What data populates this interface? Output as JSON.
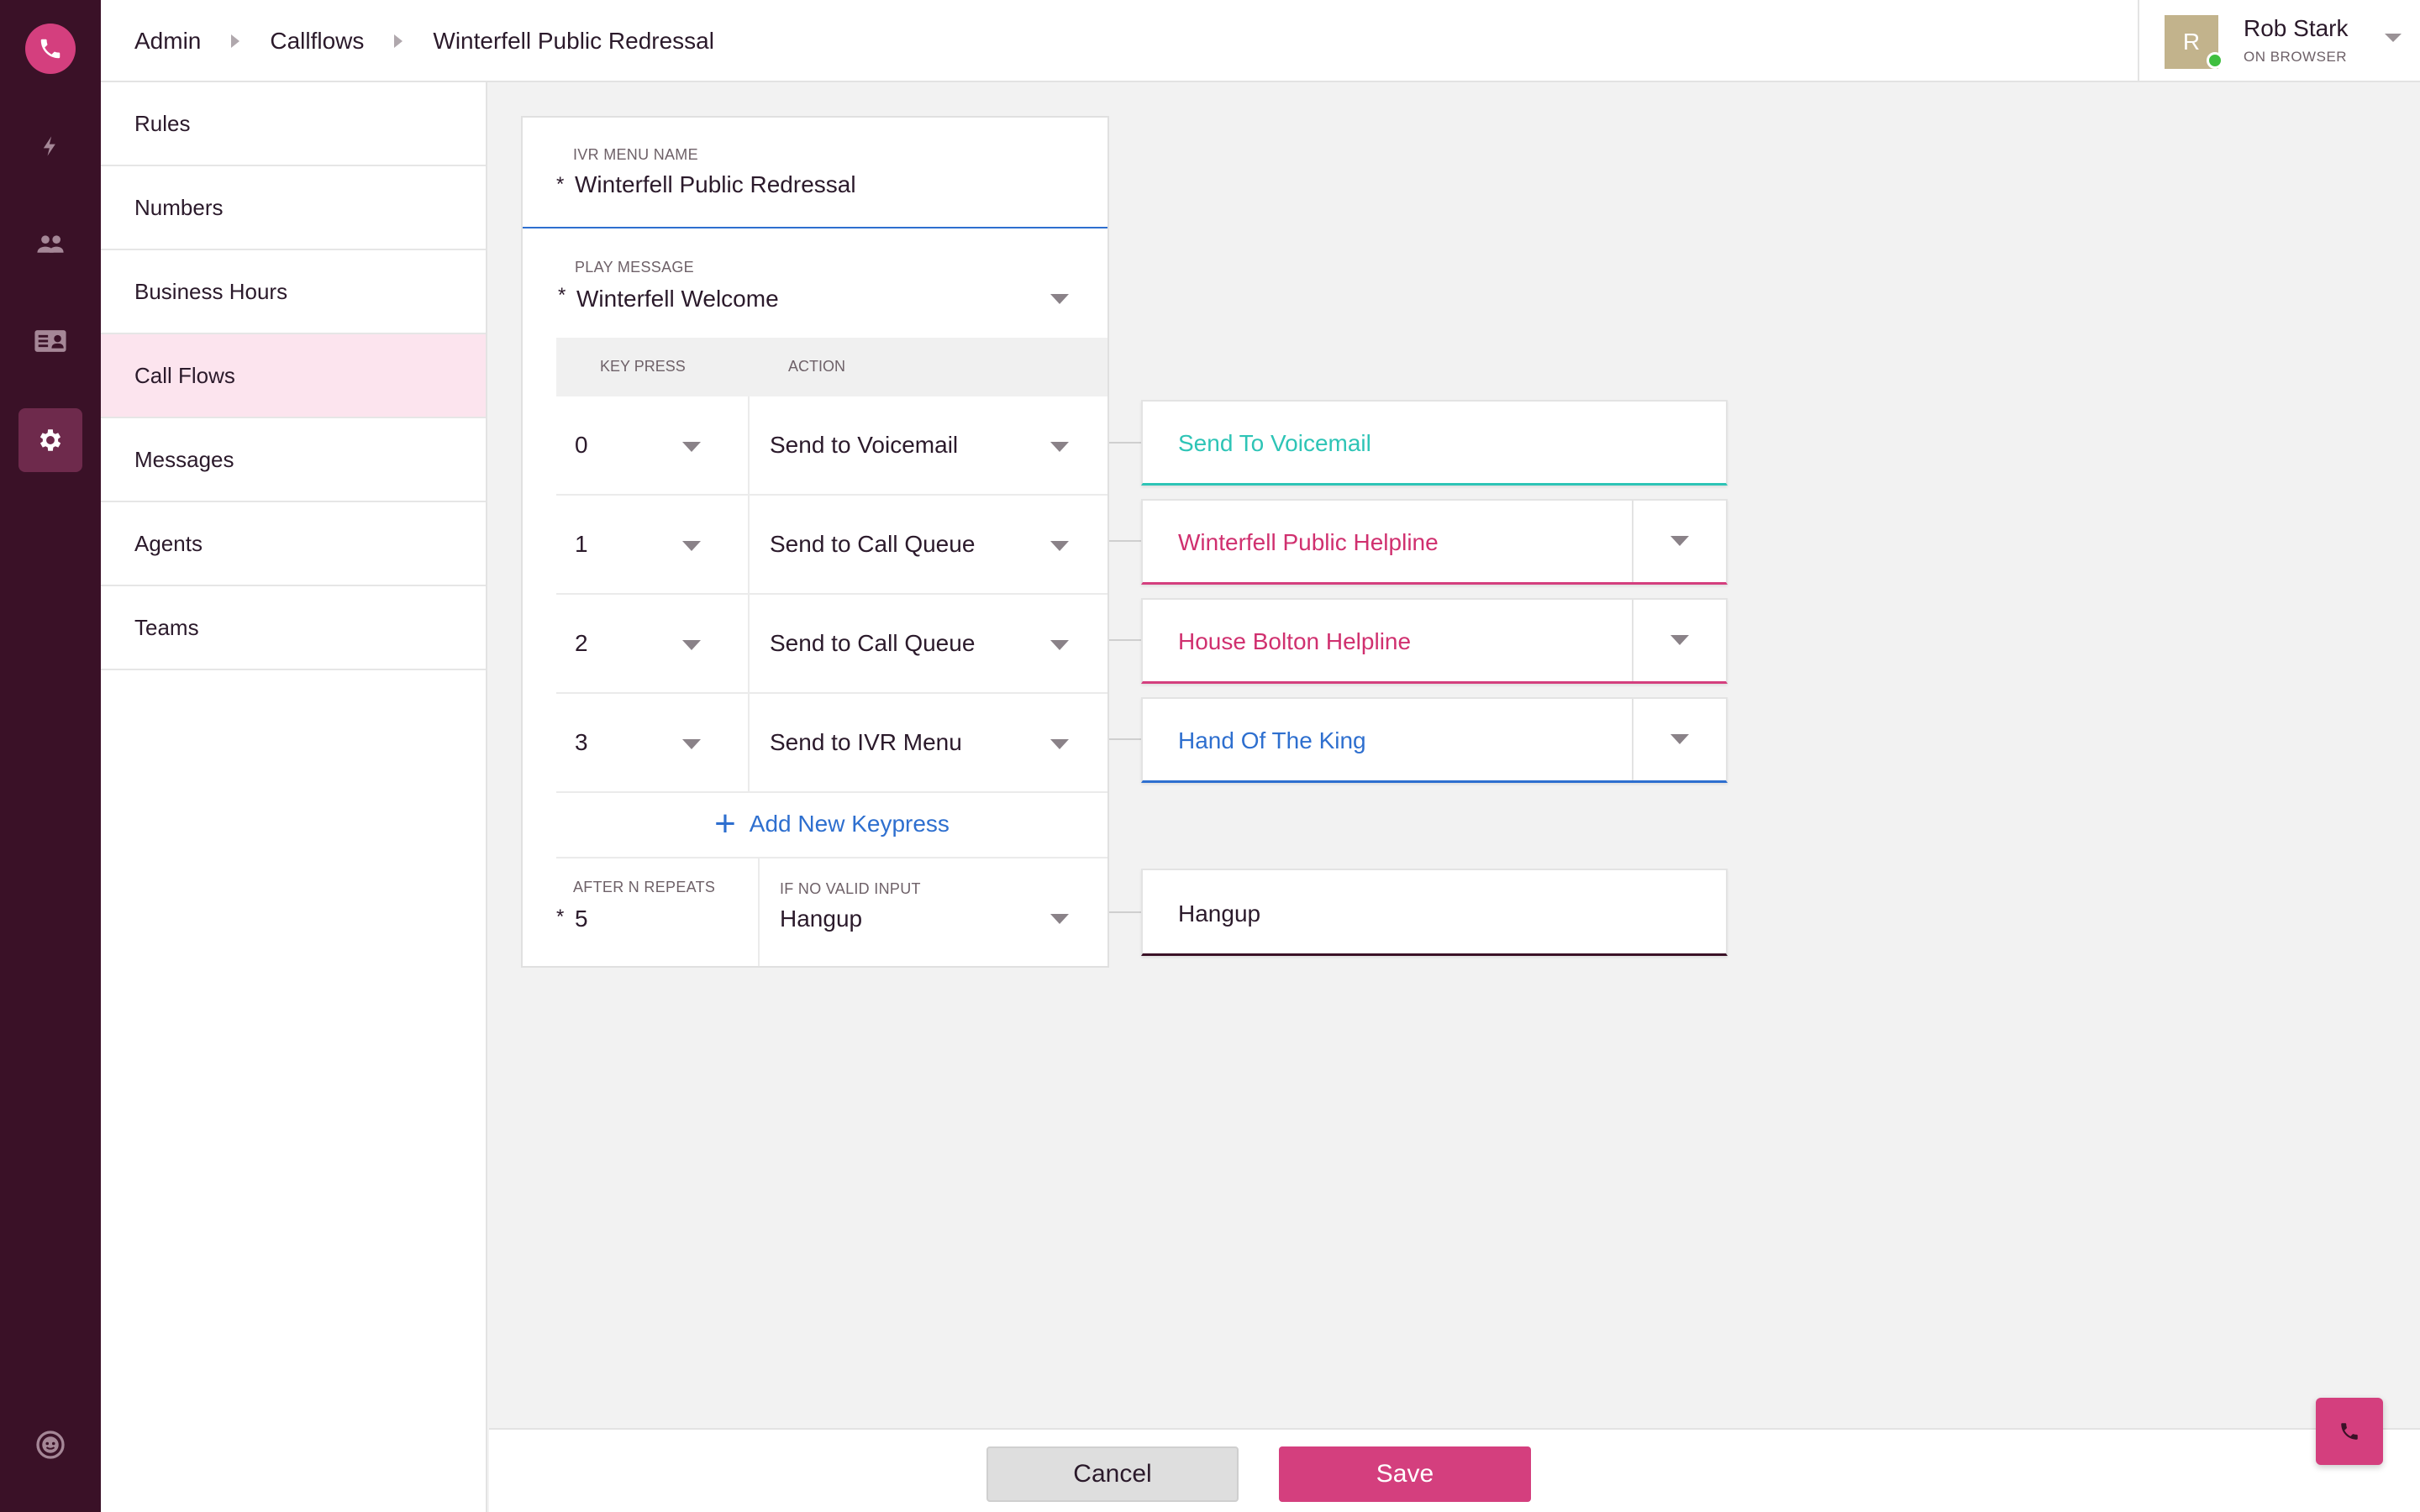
{
  "header": {
    "breadcrumb": [
      "Admin",
      "Callflows",
      "Winterfell Public Redressal"
    ],
    "user": {
      "avatar_letter": "R",
      "name": "Rob Stark",
      "status": "ON BROWSER"
    }
  },
  "rail": {
    "icons": [
      "phone-logo-icon",
      "bolt-icon",
      "people-icon",
      "contact-card-icon",
      "gear-icon",
      "support-face-icon"
    ],
    "active": "gear-icon",
    "colors": {
      "background": "#3a1127",
      "active": "#6e2a4c",
      "brand": "#d43f7e"
    }
  },
  "sidebar": {
    "items": [
      {
        "label": "Rules"
      },
      {
        "label": "Numbers"
      },
      {
        "label": "Business Hours"
      },
      {
        "label": "Call Flows",
        "active": true
      },
      {
        "label": "Messages"
      },
      {
        "label": "Agents"
      },
      {
        "label": "Teams"
      }
    ]
  },
  "ivr": {
    "name_label": "IVR MENU NAME",
    "required_mark": "*",
    "name_value": "Winterfell Public Redressal",
    "play_label": "PLAY MESSAGE",
    "play_value": "Winterfell Welcome",
    "col_key": "KEY PRESS",
    "col_action": "ACTION",
    "rows": [
      {
        "key": "0",
        "action": "Send to Voicemail",
        "target": "Send To Voicemail",
        "target_color": "#2ec4b6",
        "has_dropdown": false
      },
      {
        "key": "1",
        "action": "Send to Call Queue",
        "target": "Winterfell Public Helpline",
        "target_color": "#d0306f",
        "has_dropdown": true
      },
      {
        "key": "2",
        "action": "Send to Call Queue",
        "target": "House Bolton Helpline",
        "target_color": "#d0306f",
        "has_dropdown": true
      },
      {
        "key": "3",
        "action": "Send to IVR Menu",
        "target": "Hand Of The King",
        "target_color": "#2e6fcf",
        "has_dropdown": true
      }
    ],
    "add_keypress": "Add New Keypress",
    "repeats_label": "AFTER N REPEATS",
    "repeats_value": "5",
    "noinput_label": "IF NO VALID INPUT",
    "noinput_value": "Hangup",
    "noinput_target": "Hangup"
  },
  "actions": {
    "cancel": "Cancel",
    "save": "Save"
  }
}
